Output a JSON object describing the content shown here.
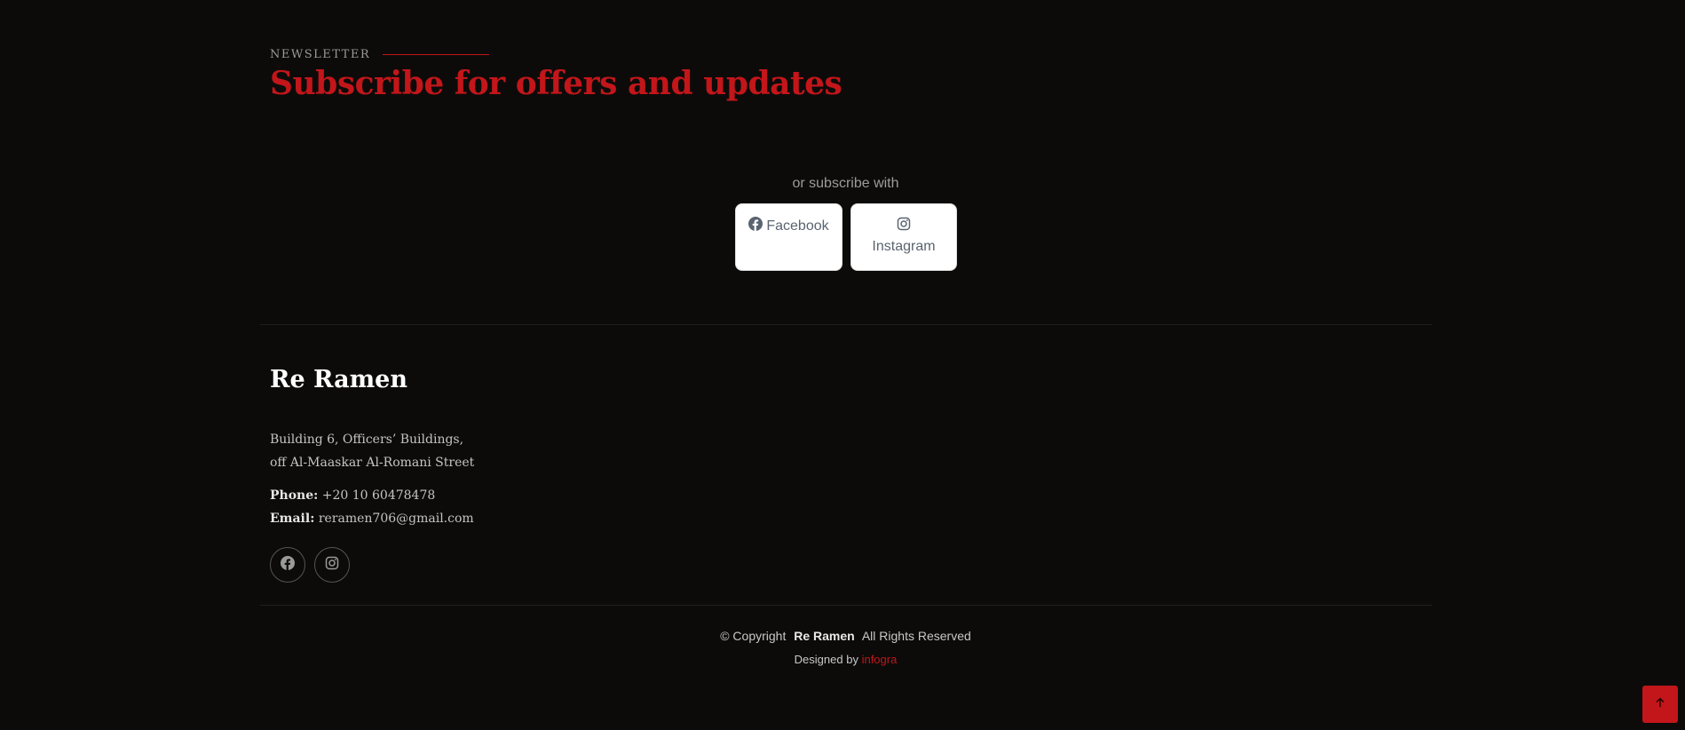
{
  "newsletter": {
    "label": "NEWSLETTER",
    "title": "Subscribe for offers and updates",
    "subscribe_with": "or subscribe with",
    "buttons": [
      {
        "label": "Facebook",
        "icon": "facebook-icon"
      },
      {
        "label": "Instagram",
        "icon": "instagram-icon"
      }
    ]
  },
  "footer": {
    "brand": "Re Ramen",
    "address_line1": "Building 6, Officers’ Buildings,",
    "address_line2": "off Al-Maaskar Al-Romani Street",
    "phone_label": "Phone:",
    "phone": "+20 10 60478478",
    "email_label": "Email:",
    "email": "reramen706@gmail.com",
    "social_icons": [
      "facebook-icon",
      "instagram-icon"
    ]
  },
  "bottom": {
    "copyright_prefix": "© Copyright",
    "copyright_brand": "Re Ramen",
    "copyright_suffix": "All Rights Reserved",
    "designed_prefix": "Designed by",
    "designer": "infogra"
  },
  "back_to_top_icon": "arrow-up-icon",
  "colors": {
    "background": "#0c0b0a",
    "accent": "#c2161a"
  }
}
